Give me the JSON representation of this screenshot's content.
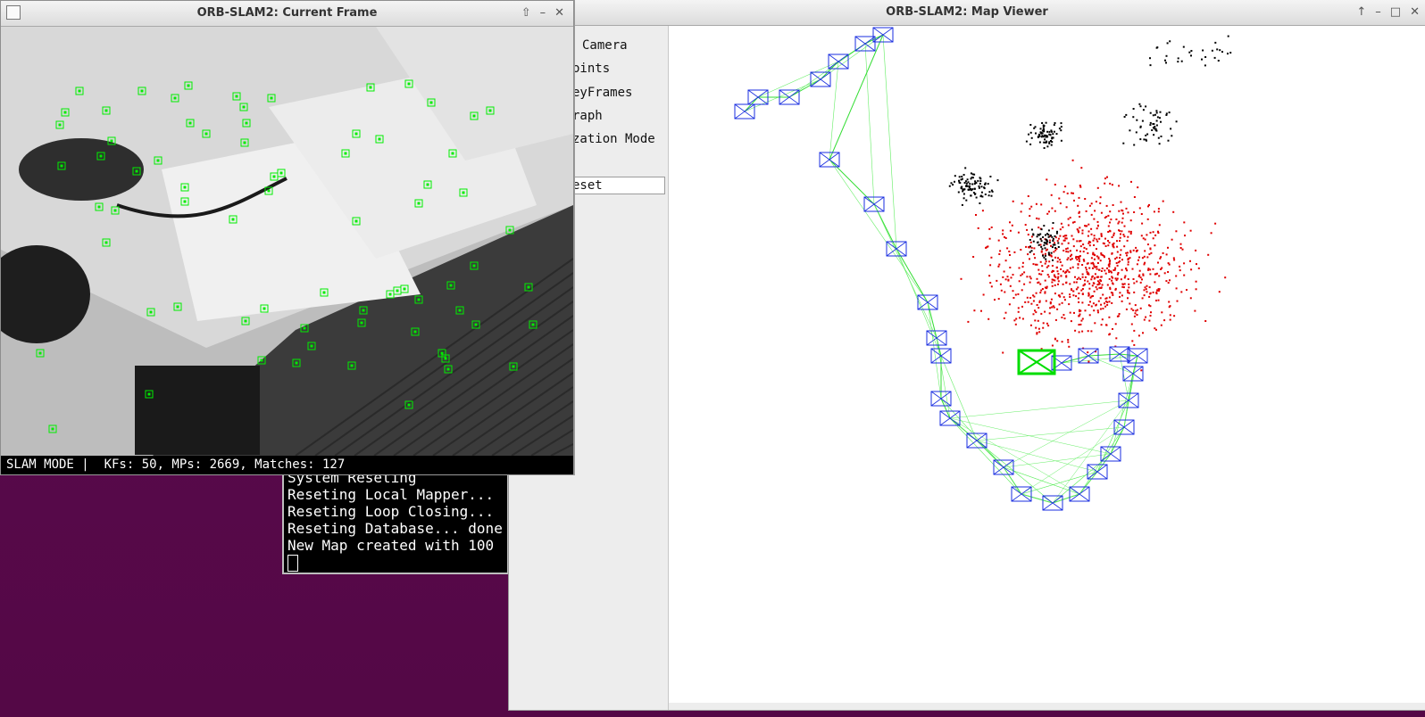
{
  "frame_window": {
    "title": "ORB-SLAM2: Current Frame",
    "status_text": "SLAM MODE |  KFs: 50, MPs: 2669, Matches: 127",
    "buttons": {
      "up": "⇧",
      "minimize": "–",
      "close": "✕"
    }
  },
  "map_window": {
    "title": "ORB-SLAM2: Map Viewer",
    "buttons": {
      "up": "↑",
      "minimize": "–",
      "maximize": "□",
      "close": "✕"
    },
    "menu": {
      "camera": "Camera",
      "points": "oints",
      "keyframes": "eyFrames",
      "graph": "raph",
      "localization": "zation Mode",
      "reset": "eset"
    }
  },
  "terminal": {
    "lines": [
      "System Reseting",
      "Reseting Local Mapper...",
      "Reseting Loop Closing...",
      "Reseting Database... done",
      "New Map created with 100"
    ]
  },
  "colors": {
    "feature": "#00ee00",
    "keyframe": "#1a2ee0",
    "mappoint_local": "#e00000",
    "mappoint_all": "#000000",
    "current_camera": "#00dd00"
  }
}
